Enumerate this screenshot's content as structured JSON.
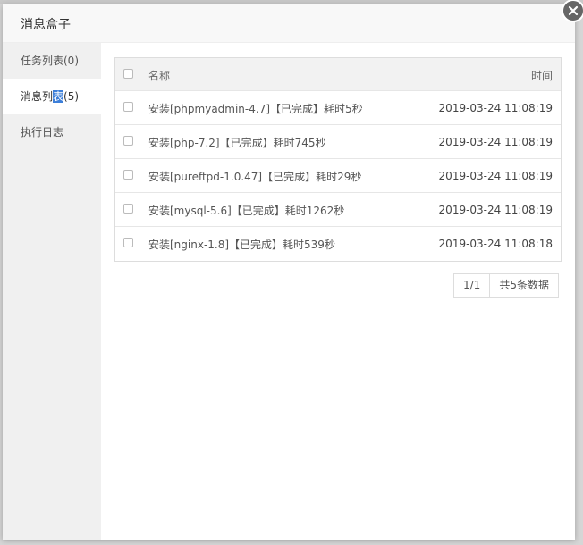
{
  "modal": {
    "title": "消息盒子"
  },
  "sidebar": {
    "items": [
      {
        "label": "任务列表(0)"
      },
      {
        "label_before": "消息列",
        "label_highlight": "表",
        "label_after": "(5)"
      },
      {
        "label": "执行日志"
      }
    ]
  },
  "table": {
    "headers": {
      "name": "名称",
      "time": "时间"
    },
    "rows": [
      {
        "name": "安装[phpmyadmin-4.7]【已完成】耗时5秒",
        "time": "2019-03-24 11:08:19"
      },
      {
        "name": "安装[php-7.2]【已完成】耗时745秒",
        "time": "2019-03-24 11:08:19"
      },
      {
        "name": "安装[pureftpd-1.0.47]【已完成】耗时29秒",
        "time": "2019-03-24 11:08:19"
      },
      {
        "name": "安装[mysql-5.6]【已完成】耗时1262秒",
        "time": "2019-03-24 11:08:19"
      },
      {
        "name": "安装[nginx-1.8]【已完成】耗时539秒",
        "time": "2019-03-24 11:08:18"
      }
    ]
  },
  "pagination": {
    "page": "1/1",
    "total": "共5条数据"
  },
  "icons": {
    "close": "close-icon",
    "checkbox": "checkbox-icon"
  },
  "colors": {
    "highlight": "#3d7fd9",
    "close_button": "#666666"
  }
}
